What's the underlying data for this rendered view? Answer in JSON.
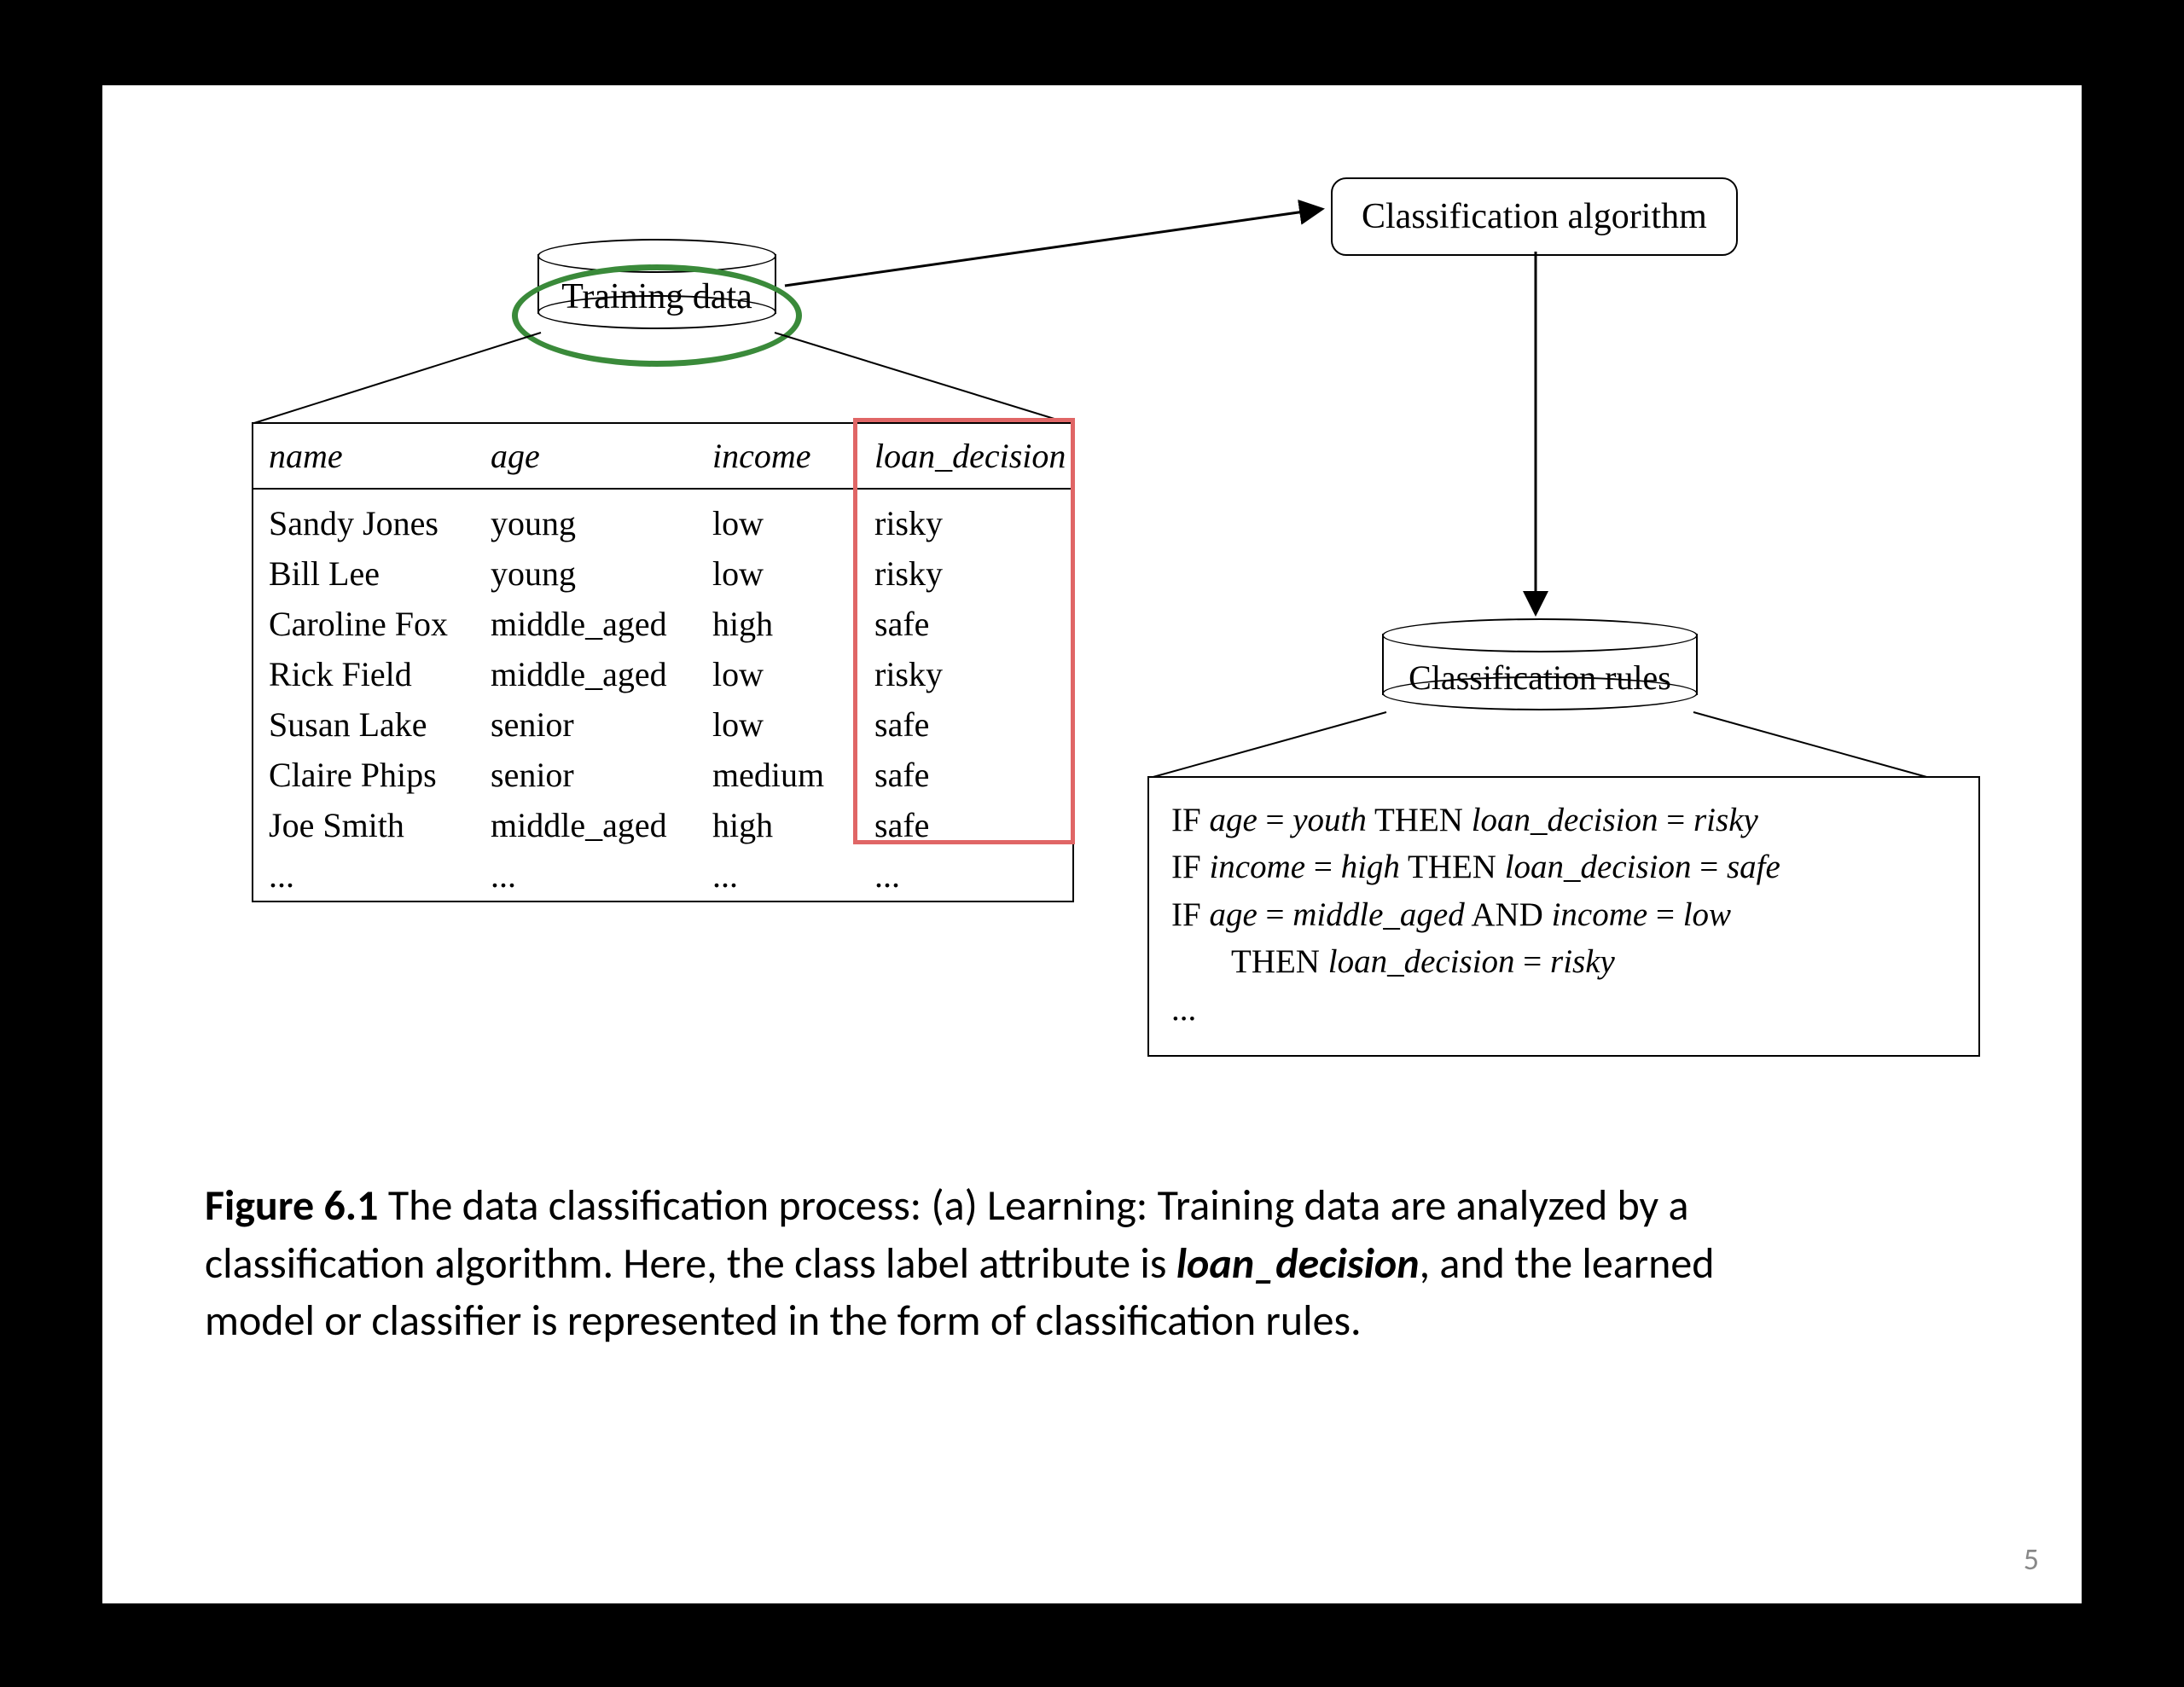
{
  "slide": {
    "page_number": "5",
    "training_data_label": "Training data",
    "algorithm_label": "Classification algorithm",
    "rules_cyl_label": "Classification rules"
  },
  "table": {
    "headers": {
      "name": "name",
      "age": "age",
      "income": "income",
      "loan": "loan_decision"
    },
    "rows": [
      {
        "name": "Sandy Jones",
        "age": "young",
        "income": "low",
        "loan": "risky"
      },
      {
        "name": "Bill Lee",
        "age": "young",
        "income": "low",
        "loan": "risky"
      },
      {
        "name": "Caroline Fox",
        "age": "middle_aged",
        "income": "high",
        "loan": "safe"
      },
      {
        "name": "Rick Field",
        "age": "middle_aged",
        "income": "low",
        "loan": "risky"
      },
      {
        "name": "Susan Lake",
        "age": "senior",
        "income": "low",
        "loan": "safe"
      },
      {
        "name": "Claire Phips",
        "age": "senior",
        "income": "medium",
        "loan": "safe"
      },
      {
        "name": "Joe Smith",
        "age": "middle_aged",
        "income": "high",
        "loan": "safe"
      }
    ],
    "ellipsis": "..."
  },
  "rules": {
    "r1": {
      "if": "IF ",
      "cond_a1": "age",
      "eq": " = ",
      "cond_v1": "youth",
      "then": " THEN ",
      "res_a": "loan_decision",
      "res_v": "risky"
    },
    "r2": {
      "if": "IF ",
      "cond_a1": "income",
      "eq": " = ",
      "cond_v1": "high",
      "then": " THEN ",
      "res_a": "loan_decision",
      "res_v": "safe"
    },
    "r3": {
      "if": "IF ",
      "cond_a1": "age",
      "eq": " = ",
      "cond_v1": "middle_aged",
      "and": " AND ",
      "cond_a2": "income",
      "cond_v2": "low",
      "then": "THEN ",
      "res_a": "loan_decision",
      "res_v": "risky"
    },
    "ellipsis": "..."
  },
  "caption": {
    "fig": "Figure 6.1",
    "sp": "  ",
    "t1": "The data classification process: (a) Learning: Training data are analyzed by a classification algorithm. Here, the class label attribute is ",
    "bi": "loan_decision",
    "t2": ", and the learned model or classifier is represented in the form of classification rules."
  }
}
